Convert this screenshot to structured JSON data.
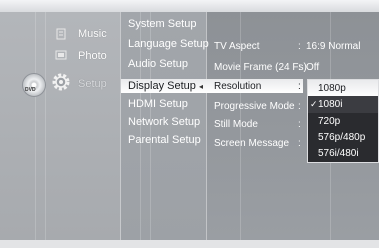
{
  "main_menu": {
    "items": [
      {
        "label": "Music",
        "icon": "music-note-icon"
      },
      {
        "label": "Photo",
        "icon": "photo-icon"
      },
      {
        "label": "Setup",
        "icon": "gear-icon"
      }
    ],
    "disc_label": "DVD"
  },
  "setup_menu": {
    "items": [
      "System Setup",
      "Language Setup",
      "Audio Setup",
      "Display Setup",
      "HDMI Setup",
      "Network Setup",
      "Parental Setup"
    ],
    "selected": "Display Setup",
    "arrow": "◂"
  },
  "display_settings": {
    "rows": [
      {
        "label": "TV Aspect",
        "colon": ":",
        "value": "16:9 Normal"
      },
      {
        "label": "Movie Frame (24 Fs)",
        "colon": ":",
        "value": "Off"
      },
      {
        "label": "Resolution",
        "colon": ":",
        "value": ""
      },
      {
        "label": "Progressive Mode",
        "colon": ":",
        "value": ""
      },
      {
        "label": "Still Mode",
        "colon": ":",
        "value": ""
      },
      {
        "label": "Screen Message",
        "colon": ":",
        "value": ""
      }
    ]
  },
  "resolution_dropdown": {
    "options": [
      "1080p",
      "1080i",
      "720p",
      "576p/480p",
      "576i/480i"
    ],
    "selected": "1080p",
    "checked": "1080i",
    "check_mark": "✓"
  }
}
